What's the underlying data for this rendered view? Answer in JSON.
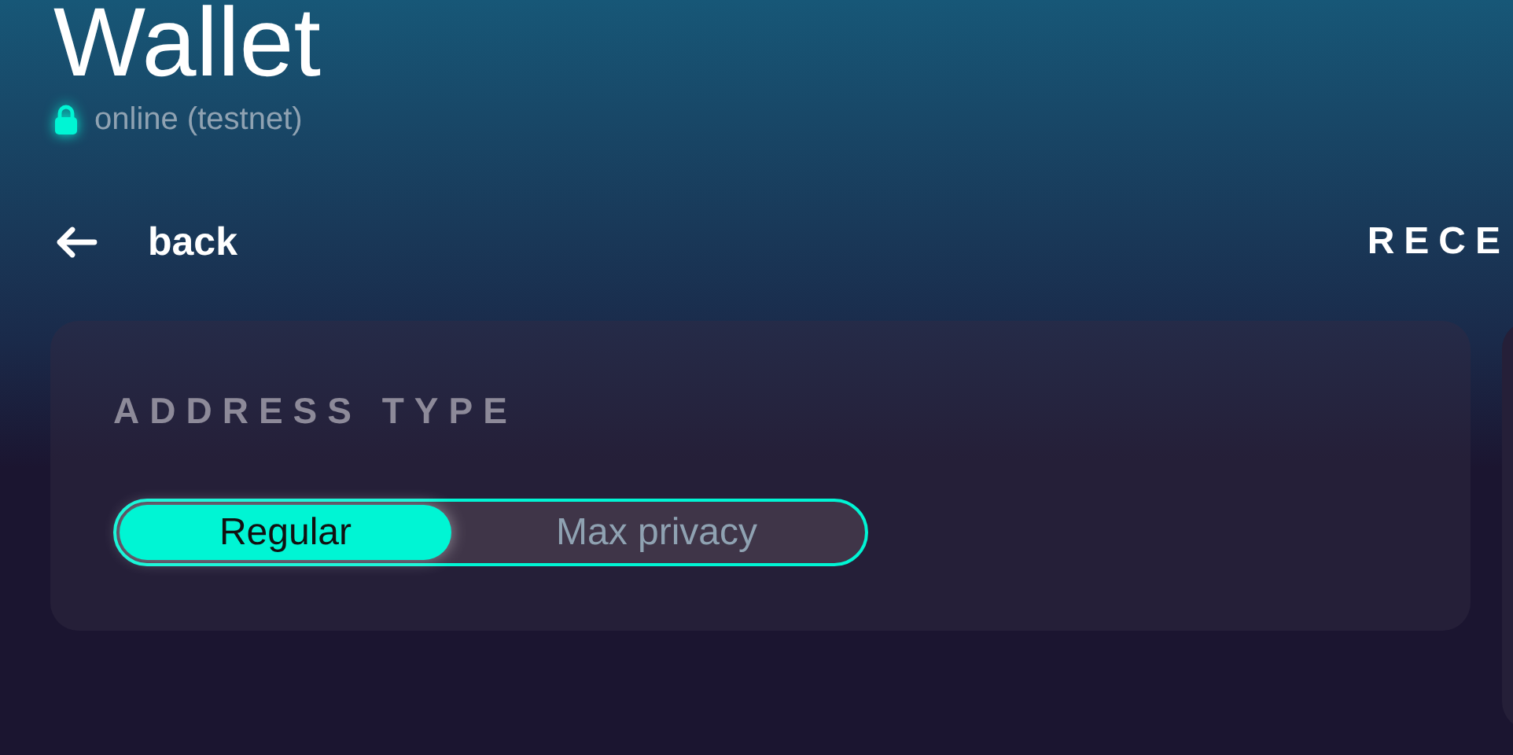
{
  "title": "Wallet",
  "status": {
    "text": "online (testnet)",
    "secure": true
  },
  "nav": {
    "back": "back",
    "section_heading": "RECE"
  },
  "address_type": {
    "heading": "ADDRESS TYPE",
    "options": [
      {
        "label": "Regular",
        "selected": true
      },
      {
        "label": "Max privacy",
        "selected": false
      }
    ]
  }
}
